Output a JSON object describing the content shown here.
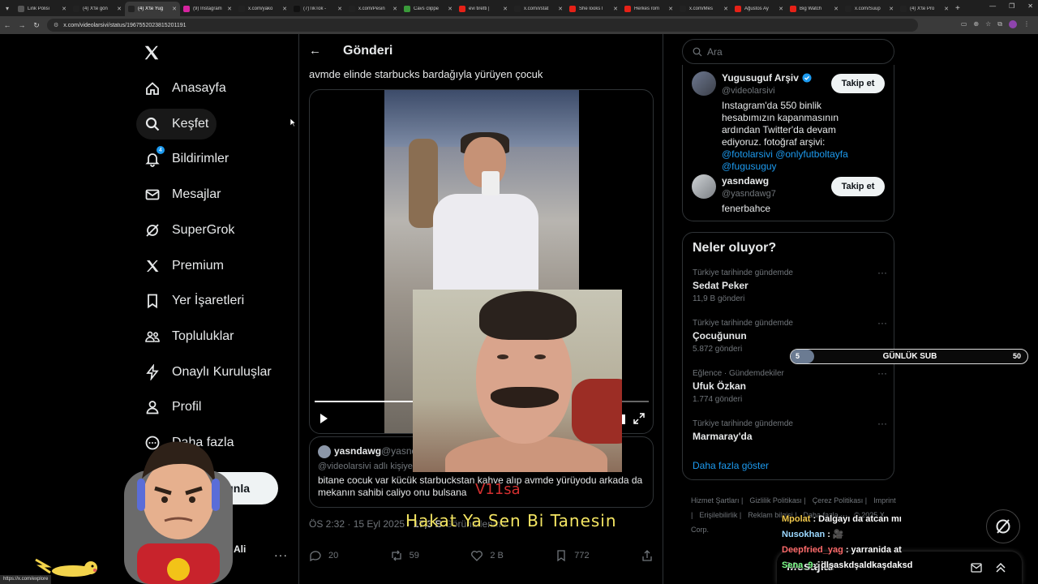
{
  "browser": {
    "tabs": [
      {
        "title": "Link Polisi",
        "color": "#555555"
      },
      {
        "title": "(4) X'te gön",
        "color": "#222222"
      },
      {
        "title": "(4) X'te Yug",
        "color": "#222222",
        "active": true
      },
      {
        "title": "(9) Instagram",
        "color": "#d6249f"
      },
      {
        "title": "x.com/yako",
        "color": "#222222"
      },
      {
        "title": "(7)TikTok -",
        "color": "#111111"
      },
      {
        "title": "x.com/Pesin",
        "color": "#222222"
      },
      {
        "title": "Cavs clippe",
        "color": "#3a9a3a"
      },
      {
        "title": "evi tiretti |",
        "color": "#e62117"
      },
      {
        "title": "x.com/i/stat",
        "color": "#222222"
      },
      {
        "title": "She looks l",
        "color": "#e62117"
      },
      {
        "title": "Herkes rom",
        "color": "#e62117"
      },
      {
        "title": "x.com/Mes",
        "color": "#222222"
      },
      {
        "title": "Ağustos Ay",
        "color": "#e62117"
      },
      {
        "title": "Big Watch",
        "color": "#e62117"
      },
      {
        "title": "x.com/Suup",
        "color": "#222222"
      },
      {
        "title": "(4) X'te Pro",
        "color": "#222222"
      }
    ],
    "url": "x.com/videolarsivi/status/1967552023815201191",
    "status_url": "https://x.com/explore"
  },
  "nav": {
    "items": [
      {
        "label": "Anasayfa",
        "icon": "home-icon"
      },
      {
        "label": "Keşfet",
        "icon": "search-icon"
      },
      {
        "label": "Bildirimler",
        "icon": "bell-icon",
        "badge": "4"
      },
      {
        "label": "Mesajlar",
        "icon": "mail-icon"
      },
      {
        "label": "SuperGrok",
        "icon": "grok-icon"
      },
      {
        "label": "Premium",
        "icon": "x-icon"
      },
      {
        "label": "Yer İşaretleri",
        "icon": "bookmark-icon"
      },
      {
        "label": "Topluluklar",
        "icon": "people-icon"
      },
      {
        "label": "Onaylı Kuruluşlar",
        "icon": "bolt-icon"
      },
      {
        "label": "Profil",
        "icon": "person-icon"
      },
      {
        "label": "Daha fazla",
        "icon": "more-icon"
      }
    ],
    "post_label": "Gönderi yayınla",
    "account_name": "Ali"
  },
  "post": {
    "header_title": "Gönderi",
    "text": "avmde elinde starbucks bardağıyla yürüyen çocuk",
    "video_progress": 0.3,
    "quote": {
      "name": "yasndawg",
      "handle": "@yasndawg7",
      "reply_to": "@videolarsivi adlı kişiye yanıt olarak",
      "body": "bitane cocuk var kücük starbuckstan kahve alıp avmde yürüyodu arkada da mekanın sahibi caliyo onu bulsana"
    },
    "time": "ÖS 2:32 · 15 Eyl 2025 ·",
    "views_count": "17,3 B",
    "views_label": "Görüntülenme",
    "actions": {
      "replies": "20",
      "reposts": "59",
      "likes": "2 B",
      "bookmarks": "772"
    }
  },
  "sidebar": {
    "search_placeholder": "Ara",
    "accounts": [
      {
        "name": "Yugusuguf Arşiv",
        "handle": "@videolarsivi",
        "verified": true,
        "follow_label": "Takip et",
        "bio": "Instagram'da 550 binlik hesabımızın kapanmasının ardından Twitter'da devam ediyoruz. fotoğraf arşivi:",
        "mentions": "@fotolarsivi @onlyfutboltayfa @fugusuguy"
      },
      {
        "name": "yasndawg",
        "handle": "@yasndawg7",
        "verified": false,
        "follow_label": "Takip et",
        "bio": "fenerbahce",
        "mentions": ""
      }
    ],
    "trends_title": "Neler oluyor?",
    "trends": [
      {
        "context": "Türkiye tarihinde gündemde",
        "name": "Sedat Peker",
        "count": "11,9 B gönderi"
      },
      {
        "context": "Türkiye tarihinde gündemde",
        "name": "Çocuğunun",
        "count": "5.872 gönderi"
      },
      {
        "context": "Eğlence · Gündemdekiler",
        "name": "Ufuk Özkan",
        "count": "1.774 gönderi"
      },
      {
        "context": "Türkiye tarihinde gündemde",
        "name": "Marmaray'da",
        "count": ""
      }
    ],
    "trends_more": "Daha fazla göster",
    "footer": [
      "Hizmet Şartları |",
      "Gizlilik Politikası |",
      "Çerez Politikası |",
      "Imprint |",
      "Erişilebilirlik |",
      "Reklam bilgisi |",
      "Daha fazla ···",
      "© 2025 X Corp."
    ]
  },
  "stream": {
    "subtitle_top": "V11sa",
    "subtitle_line": "Hakat Ya Sen Bi Tanesin",
    "goal": {
      "current": "5",
      "label": "GÜNLÜK SUB",
      "target": "50",
      "fraction": 0.1
    },
    "chat": [
      {
        "user": "Mpolat",
        "color": "#f2c94c",
        "message": "Dalgayı da atcan mı"
      },
      {
        "user": "Nusokhan",
        "color": "#9bd8ff",
        "message": "🎥"
      },
      {
        "user": "Deepfried_yag",
        "color": "#ff6b6b",
        "message": "yarranida at"
      },
      {
        "user": "Sena_9",
        "color": "#7dff8a",
        "message": "dlşaskdşaldkaşdaksd"
      }
    ]
  },
  "messages_drawer": {
    "title": "Mesajlar"
  }
}
